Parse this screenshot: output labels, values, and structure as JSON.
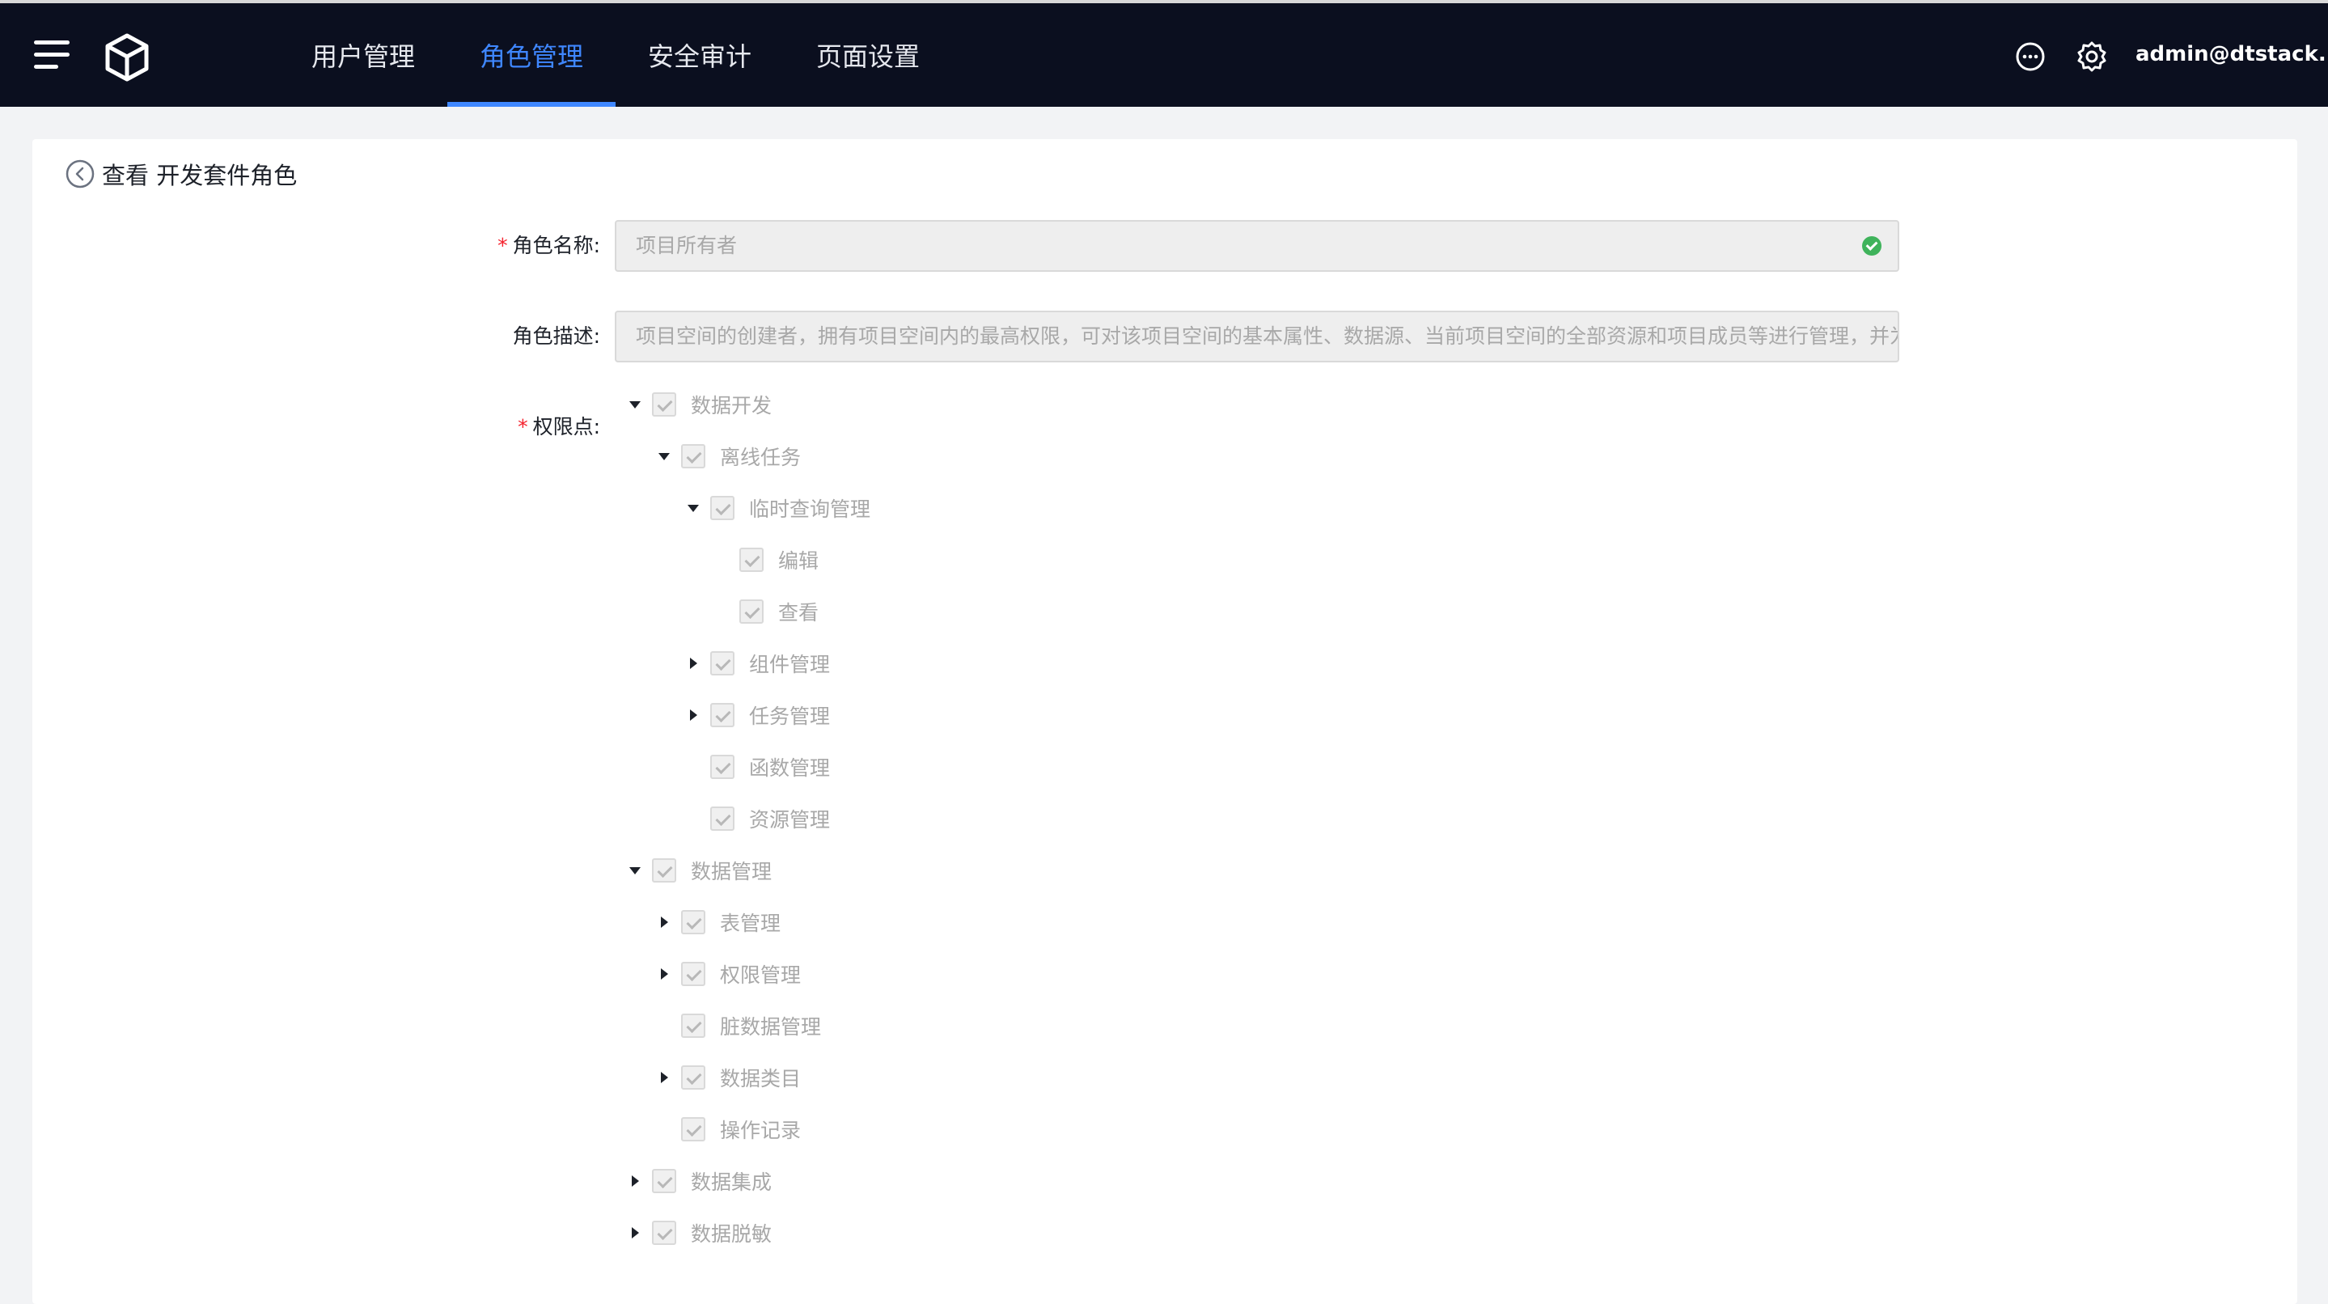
{
  "header": {
    "tabs": [
      {
        "label": "用户管理",
        "active": false
      },
      {
        "label": "角色管理",
        "active": true
      },
      {
        "label": "安全审计",
        "active": false
      },
      {
        "label": "页面设置",
        "active": false
      }
    ],
    "user": "admin@dtstack...",
    "icons": [
      "menu-icon",
      "cube-logo-icon",
      "chat-icon",
      "gear-icon"
    ],
    "accent_color": "#3f87ff",
    "bg_color": "#0b0f1f"
  },
  "page": {
    "title": "查看 开发套件角色",
    "back_icon": "back-circle-icon"
  },
  "form": {
    "role_name_label": "角色名称:",
    "role_name_value": "项目所有者",
    "role_desc_label": "角色描述:",
    "role_desc_value": "项目空间的创建者，拥有项目空间内的最高权限，可对该项目空间的基本属性、数据源、当前项目空间的全部资源和项目成员等进行管理，并为项",
    "permissions_label": "权限点:",
    "required_mark": "*"
  },
  "permissions_tree": [
    {
      "label": "数据开发",
      "level": 0,
      "caret": "down",
      "checked": true
    },
    {
      "label": "离线任务",
      "level": 1,
      "caret": "down",
      "checked": true
    },
    {
      "label": "临时查询管理",
      "level": 2,
      "caret": "down",
      "checked": true
    },
    {
      "label": "编辑",
      "level": 3,
      "caret": "none",
      "checked": true
    },
    {
      "label": "查看",
      "level": 3,
      "caret": "none",
      "checked": true
    },
    {
      "label": "组件管理",
      "level": 2,
      "caret": "right",
      "checked": true
    },
    {
      "label": "任务管理",
      "level": 2,
      "caret": "right",
      "checked": true
    },
    {
      "label": "函数管理",
      "level": 2,
      "caret": "none",
      "checked": true
    },
    {
      "label": "资源管理",
      "level": 2,
      "caret": "none",
      "checked": true
    },
    {
      "label": "数据管理",
      "level": 0,
      "caret": "down",
      "checked": true
    },
    {
      "label": "表管理",
      "level": 1,
      "caret": "right",
      "checked": true
    },
    {
      "label": "权限管理",
      "level": 1,
      "caret": "right",
      "checked": true
    },
    {
      "label": "脏数据管理",
      "level": 1,
      "caret": "none",
      "checked": true
    },
    {
      "label": "数据类目",
      "level": 1,
      "caret": "right",
      "checked": true
    },
    {
      "label": "操作记录",
      "level": 1,
      "caret": "none",
      "checked": true
    },
    {
      "label": "数据集成",
      "level": 0,
      "caret": "right",
      "checked": true
    },
    {
      "label": "数据脱敏",
      "level": 0,
      "caret": "right",
      "checked": true
    }
  ]
}
